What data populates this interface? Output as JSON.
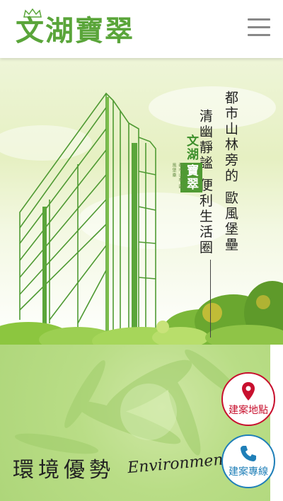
{
  "header": {
    "logo_text": "文湖寶翠",
    "menu_icon": "hamburger-menu-icon"
  },
  "hero": {
    "slogan_line1": "都市山林旁的 歐風堡壘",
    "slogan_line2": "清幽靜謐 便利生活圈",
    "brand_part1": "文湖",
    "brand_part2": "寶翠",
    "brand_small": "都市山林 歐風堡壘"
  },
  "environment": {
    "title": "環境優勢",
    "subtitle": "Environment"
  },
  "fab": {
    "location_label": "建案地點",
    "location_icon": "map-pin-icon",
    "location_color": "#c8102e",
    "phone_label": "建案專線",
    "phone_icon": "phone-icon",
    "phone_color": "#1f7fb8"
  },
  "colors": {
    "brand_green": "#5aa53a"
  }
}
